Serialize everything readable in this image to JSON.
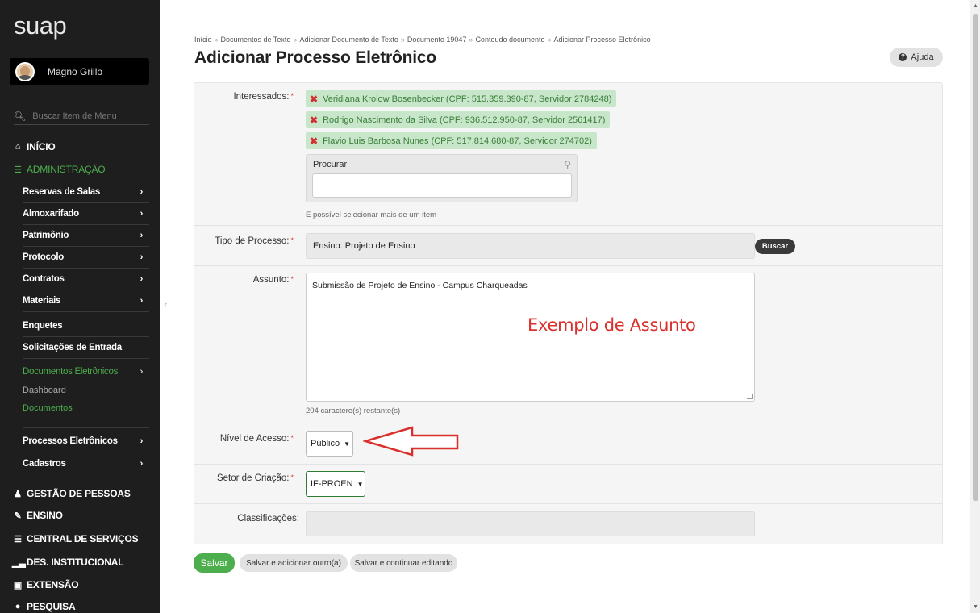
{
  "app": {
    "logo": "suap"
  },
  "user": {
    "name": "Magno Grillo"
  },
  "sidebar": {
    "search_placeholder": "Buscar Item de Menu",
    "top_items": [
      {
        "label": "INÍCIO",
        "icon": "home-icon"
      },
      {
        "label": "ADMINISTRAÇÃO",
        "icon": "list-icon"
      },
      {
        "label": "GESTÃO DE PESSOAS",
        "icon": "users-icon"
      },
      {
        "label": "ENSINO",
        "icon": "pencil-icon"
      },
      {
        "label": "CENTRAL DE SERVIÇOS",
        "icon": "list-icon"
      },
      {
        "label": "DES. INSTITUCIONAL",
        "icon": "bar-chart-icon"
      },
      {
        "label": "EXTENSÃO",
        "icon": "briefcase-icon"
      },
      {
        "label": "PESQUISA",
        "icon": "globe-icon"
      }
    ],
    "sub_items": [
      {
        "label": "Reservas de Salas",
        "chevron": "›"
      },
      {
        "label": "Almoxarifado",
        "chevron": "›"
      },
      {
        "label": "Patrimônio",
        "chevron": "›"
      },
      {
        "label": "Protocolo",
        "chevron": "›"
      },
      {
        "label": "Contratos",
        "chevron": "›"
      },
      {
        "label": "Materiais",
        "chevron": "›"
      },
      {
        "label": "Enquetes",
        "chevron": ""
      },
      {
        "label": "Solicitações de Entrada",
        "chevron": ""
      },
      {
        "label": "Documentos Eletrônicos",
        "chevron": "›"
      },
      {
        "label": "Processos Eletrônicos",
        "chevron": "›"
      },
      {
        "label": "Cadastros",
        "chevron": "›"
      }
    ],
    "sub_sub_items": [
      {
        "label": "Dashboard"
      },
      {
        "label": "Documentos"
      }
    ]
  },
  "breadcrumb": [
    "Início",
    "Documentos de Texto",
    "Adicionar Documento de Texto",
    "Documento 19047",
    "Conteudo documento",
    "Adicionar Processo Eletrônico"
  ],
  "breadcrumb_separator": "»",
  "page": {
    "title": "Adicionar Processo Eletrônico",
    "help_label": "Ajuda"
  },
  "form": {
    "required_mark": "*",
    "interessados": {
      "label": "Interessados:",
      "tags": [
        "Veridiana Krolow Bosenbecker (CPF: 515.359.390-87, Servidor 2784248)",
        "Rodrigo Nascimento da Silva (CPF: 936.512.950-87, Servidor 2561417)",
        "Flavio Luis Barbosa Nunes (CPF: 517.814.680-87, Servidor 274702)"
      ],
      "search_label": "Procurar",
      "help": "É possível selecionar mais de um item"
    },
    "tipo_processo": {
      "label": "Tipo de Processo:",
      "value": "Ensino: Projeto de Ensino",
      "button": "Buscar"
    },
    "assunto": {
      "label": "Assunto:",
      "value": "Submissão de Projeto de Ensino - Campus Charqueadas",
      "help": "204 caractere(s) restante(s)",
      "annotation": "Exemplo de Assunto"
    },
    "nivel_acesso": {
      "label": "Nível de Acesso:",
      "value": "Público"
    },
    "setor_criacao": {
      "label": "Setor de Criação:",
      "value": "IF-PROEN"
    },
    "classificacoes": {
      "label": "Classificações:"
    }
  },
  "actions": {
    "save": "Salvar",
    "save_add": "Salvar e adicionar outro(a)",
    "save_edit": "Salvar e continuar editando"
  },
  "colors": {
    "sidebar_bg": "#1e1e1e",
    "accent_green": "#4cae4c",
    "tag_bg": "#c8e6c9",
    "annotation_red": "#d9302c"
  }
}
